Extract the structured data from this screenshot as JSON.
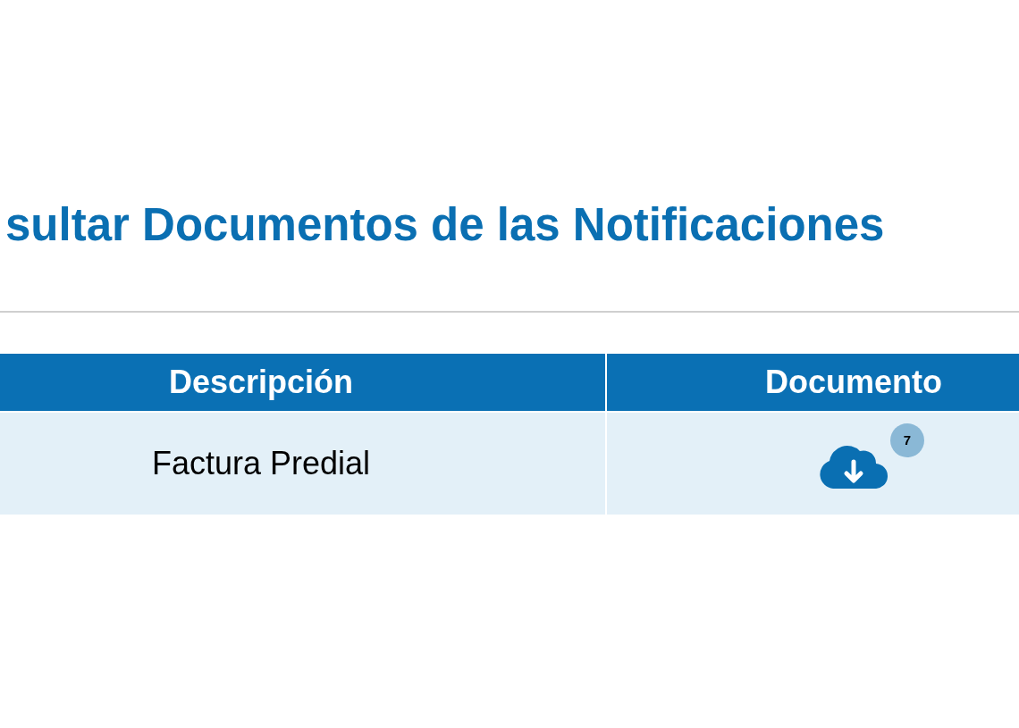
{
  "page_title": "sultar Documentos de las Notificaciones",
  "table": {
    "columns": [
      "Descripción",
      "Documento"
    ],
    "rows": [
      {
        "description": "Factura Predial",
        "document": {
          "badge": "7"
        }
      }
    ]
  }
}
